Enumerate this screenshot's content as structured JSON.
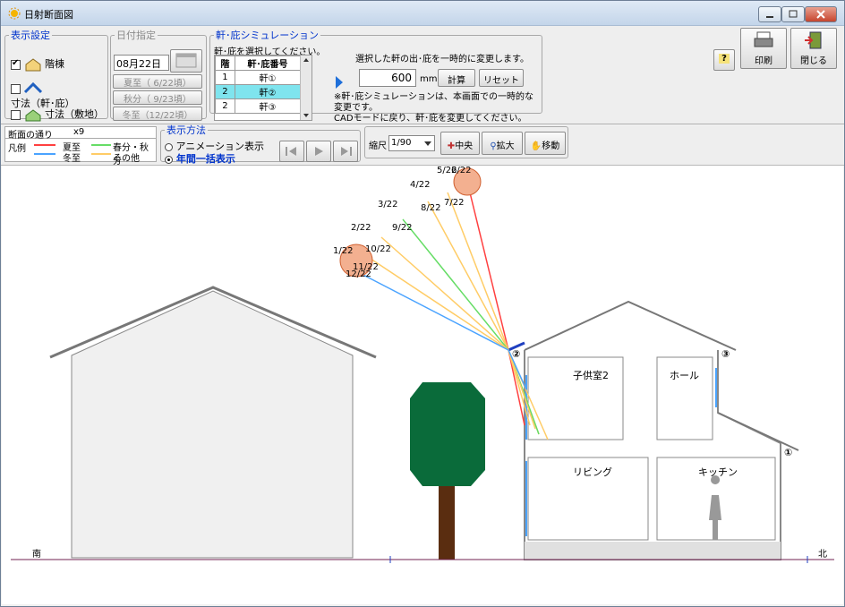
{
  "window": {
    "title": "日射断面図"
  },
  "display_settings": {
    "legend": "表示設定",
    "floor_label": "階棟",
    "floor_checked": true,
    "eaves_label": "寸法（軒･庇）",
    "eaves_checked": false,
    "site_label": "寸法（敷地）",
    "site_checked": false
  },
  "date_spec": {
    "legend": "日付指定",
    "date_value": "08月22日",
    "summer_button": "夏至（ 6/22頃）",
    "autumn_button": "秋分（ 9/23頃）",
    "winter_button": "冬至（12/22頃）"
  },
  "eaves_sim": {
    "legend": "軒･庇シミュレーション",
    "instruction": "軒･庇を選択してください。",
    "col_floor": "階",
    "col_eaves": "軒･庇番号",
    "rows": [
      {
        "floor": "1",
        "eaves": "軒①"
      },
      {
        "floor": "2",
        "eaves": "軒②"
      },
      {
        "floor": "2",
        "eaves": "軒③"
      }
    ],
    "change_text": "選択した軒の出･庇を一時的に変更します。",
    "value": "600",
    "unit": "mm",
    "calc_button": "計算",
    "reset_button": "リセット",
    "note": "※軒･庇シミュレーションは、本画面での一時的な変更です。\nCADモードに戻り、軒･庇を変更してください。"
  },
  "actions": {
    "help_label": "?",
    "print_label": "印刷",
    "close_label": "閉じる"
  },
  "section": {
    "label": "断面の通り",
    "value": "x9"
  },
  "legend": {
    "title": "凡例",
    "summer": "夏至",
    "spring_autumn": "春分・秋分",
    "winter": "冬至",
    "other": "その他",
    "colors": {
      "summer": "#ff4040",
      "spring_autumn": "#66dd66",
      "winter": "#4aa3ff",
      "other": "#ffcc66"
    }
  },
  "display_method": {
    "legend": "表示方法",
    "animation": "アニメーション表示",
    "annual": "年間一括表示",
    "selected": "annual"
  },
  "scale": {
    "label": "縮尺",
    "value": "1/90"
  },
  "view_buttons": {
    "center": "中央",
    "zoom": "拡大",
    "move": "移動"
  },
  "chart": {
    "south": "南",
    "north": "北",
    "date_labels": [
      "1/22",
      "2/22",
      "3/22",
      "4/22",
      "5/22",
      "6/22",
      "7/22",
      "8/22",
      "9/22",
      "10/22",
      "11/22",
      "12/22"
    ],
    "rooms": {
      "kids": "子供室2",
      "hall": "ホール",
      "living": "リビング",
      "kitchen": "キッチン"
    },
    "eaves_marks": [
      "②",
      "③",
      "①"
    ]
  }
}
